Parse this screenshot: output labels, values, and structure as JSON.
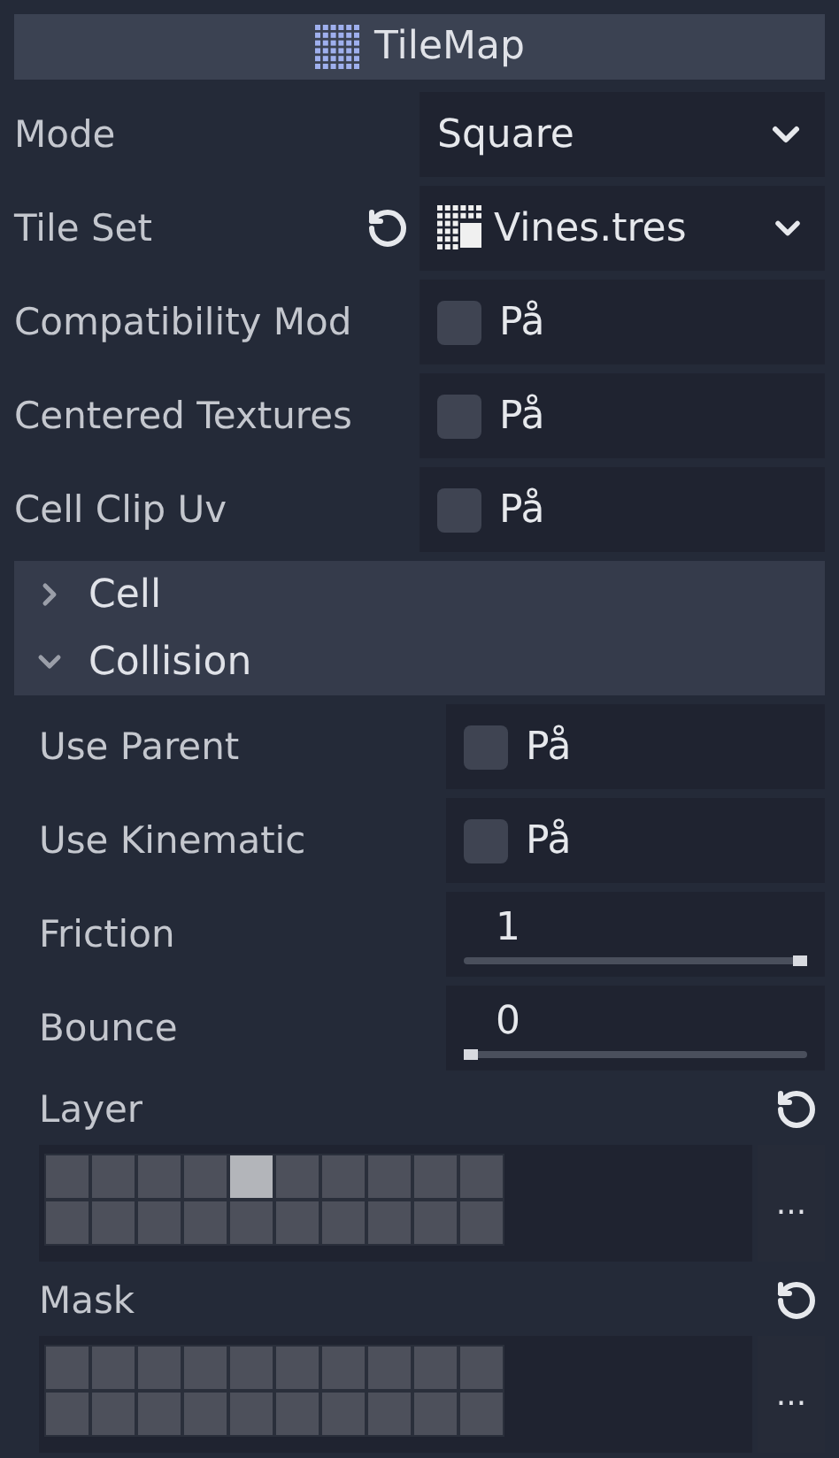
{
  "header": {
    "title": "TileMap"
  },
  "properties": [
    {
      "kind": "dropdown",
      "label": "Mode",
      "value": "Square",
      "revertable": false
    },
    {
      "kind": "resource",
      "label": "Tile Set",
      "value": "Vines.tres",
      "revertable": true
    },
    {
      "kind": "checkbox",
      "label": "Compatibility Mod",
      "value": "På",
      "checked": false
    },
    {
      "kind": "checkbox",
      "label": "Centered Textures",
      "value": "På",
      "checked": false
    },
    {
      "kind": "checkbox",
      "label": "Cell Clip Uv",
      "value": "På",
      "checked": false
    }
  ],
  "sections": [
    {
      "label": "Cell",
      "expanded": false
    },
    {
      "label": "Collision",
      "expanded": true,
      "properties": [
        {
          "kind": "checkbox",
          "label": "Use Parent",
          "value": "På",
          "checked": false
        },
        {
          "kind": "checkbox",
          "label": "Use Kinematic",
          "value": "På",
          "checked": false
        },
        {
          "kind": "slider",
          "label": "Friction",
          "value": "1",
          "level": 1
        },
        {
          "kind": "slider",
          "label": "Bounce",
          "value": "0",
          "level": 0
        },
        {
          "kind": "layers",
          "label": "Layer",
          "revertable": true,
          "more": "...",
          "bits": [
            {
              "on": false
            },
            {
              "on": false
            },
            {
              "on": false
            },
            {
              "on": false
            },
            {
              "on": true
            },
            {
              "on": false
            },
            {
              "on": false
            },
            {
              "on": false
            },
            {
              "on": false
            },
            {
              "on": false
            },
            {
              "on": false
            },
            {
              "on": false
            },
            {
              "on": false
            },
            {
              "on": false
            },
            {
              "on": false
            },
            {
              "on": false
            },
            {
              "on": false
            },
            {
              "on": false
            },
            {
              "on": false
            },
            {
              "on": false
            }
          ]
        },
        {
          "kind": "layers",
          "label": "Mask",
          "revertable": true,
          "more": "...",
          "bits": [
            {
              "on": false
            },
            {
              "on": false
            },
            {
              "on": false
            },
            {
              "on": false
            },
            {
              "on": false
            },
            {
              "on": false
            },
            {
              "on": false
            },
            {
              "on": false
            },
            {
              "on": false
            },
            {
              "on": false
            },
            {
              "on": false
            },
            {
              "on": false
            },
            {
              "on": false
            },
            {
              "on": false
            },
            {
              "on": false
            },
            {
              "on": false
            },
            {
              "on": false
            },
            {
              "on": false
            },
            {
              "on": false
            },
            {
              "on": false
            }
          ]
        }
      ]
    }
  ]
}
